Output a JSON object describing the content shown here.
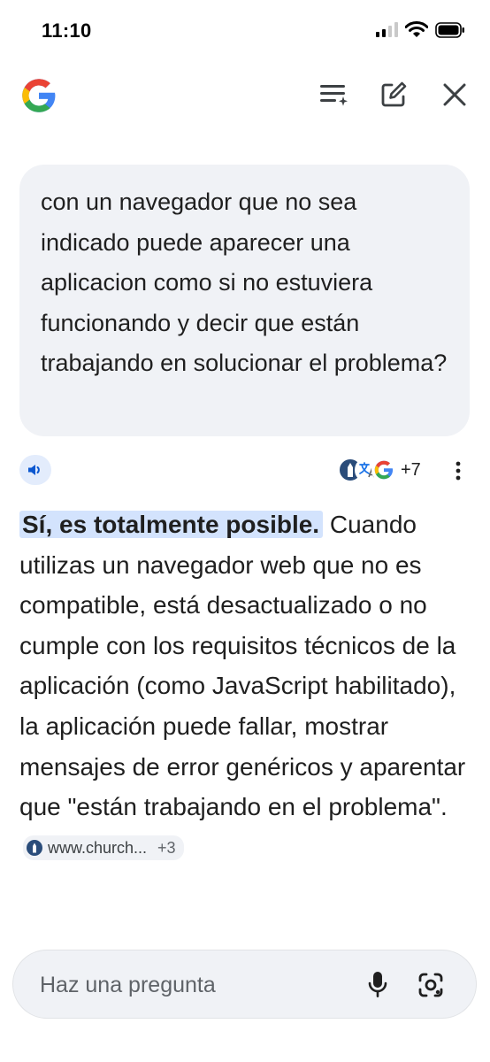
{
  "status_bar": {
    "time": "11:10",
    "icons": [
      "cellular-signal-icon",
      "wifi-icon",
      "battery-icon"
    ]
  },
  "header": {
    "logo": "google-g-logo",
    "buttons": [
      {
        "icon": "task-list-icon",
        "label": "history"
      },
      {
        "icon": "edit-icon",
        "label": "new chat"
      },
      {
        "icon": "close-icon",
        "label": "close"
      }
    ]
  },
  "conversation": {
    "user_message": "con un navegador que no sea indicado puede aparecer una aplicacion como si no estuviera funcionando y decir que están trabajando en solucionar el problema?",
    "response": {
      "sources_count": "+7",
      "highlight": "Sí, es totalmente posible.",
      "body": "Cuando utilizas un navegador web que no es compatible, está desactualizado o no cumple con los requisitos técnicos de la aplicación (como JavaScript habilitado), la aplicación puede fallar, mostrar mensajes de error genéricos y aparentar que \"están trabajando en el problema\".",
      "citation": {
        "site": "www.church...",
        "extra": "+3"
      }
    }
  },
  "ask_bar": {
    "placeholder": "Haz una pregunta",
    "value": ""
  },
  "colors": {
    "highlight": "#d3e3fd",
    "bubble_bg": "#f0f2f6",
    "text": "#1f1f1f"
  }
}
